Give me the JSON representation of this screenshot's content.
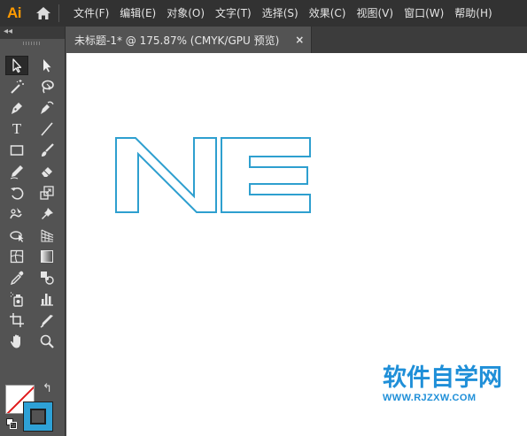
{
  "app": {
    "logo_text": "Ai",
    "logo_color": "#ff9a00",
    "home_icon": "home-icon"
  },
  "menu": {
    "items": [
      {
        "label": "文件(F)"
      },
      {
        "label": "编辑(E)"
      },
      {
        "label": "对象(O)"
      },
      {
        "label": "文字(T)"
      },
      {
        "label": "选择(S)"
      },
      {
        "label": "效果(C)"
      },
      {
        "label": "视图(V)"
      },
      {
        "label": "窗口(W)"
      },
      {
        "label": "帮助(H)"
      }
    ]
  },
  "document_tab": {
    "title": "未标题-1* @ 175.87% (CMYK/GPU 预览)",
    "close_label": "×"
  },
  "toolbar": {
    "collapse_label": "◂◂",
    "tools": [
      {
        "name": "selection-tool",
        "icon": "selection-arrow-icon",
        "active": true
      },
      {
        "name": "direct-selection-tool",
        "icon": "direct-selection-arrow-icon"
      },
      {
        "name": "magic-wand-tool",
        "icon": "magic-wand-icon"
      },
      {
        "name": "lasso-tool",
        "icon": "lasso-icon"
      },
      {
        "name": "pen-tool",
        "icon": "pen-icon"
      },
      {
        "name": "curvature-tool",
        "icon": "curvature-pen-icon"
      },
      {
        "name": "type-tool",
        "icon": "type-icon",
        "label": "T"
      },
      {
        "name": "line-segment-tool",
        "icon": "line-icon"
      },
      {
        "name": "rectangle-tool",
        "icon": "rectangle-icon"
      },
      {
        "name": "paintbrush-tool",
        "icon": "paintbrush-icon"
      },
      {
        "name": "pencil-tool",
        "icon": "pencil-icon"
      },
      {
        "name": "eraser-tool",
        "icon": "eraser-icon"
      },
      {
        "name": "rotate-tool",
        "icon": "rotate-icon"
      },
      {
        "name": "scale-tool",
        "icon": "scale-icon"
      },
      {
        "name": "warp-tool",
        "icon": "warp-icon"
      },
      {
        "name": "puppet-warp-tool",
        "icon": "pushpin-icon"
      },
      {
        "name": "free-transform-tool",
        "icon": "free-transform-icon"
      },
      {
        "name": "perspective-grid-tool",
        "icon": "perspective-grid-icon"
      },
      {
        "name": "mesh-tool",
        "icon": "mesh-icon"
      },
      {
        "name": "gradient-tool",
        "icon": "gradient-icon"
      },
      {
        "name": "eyedropper-tool",
        "icon": "eyedropper-icon"
      },
      {
        "name": "blend-tool",
        "icon": "blend-icon"
      },
      {
        "name": "symbol-sprayer-tool",
        "icon": "symbol-sprayer-icon"
      },
      {
        "name": "column-graph-tool",
        "icon": "column-graph-icon"
      },
      {
        "name": "artboard-tool",
        "icon": "artboard-icon"
      },
      {
        "name": "slice-tool",
        "icon": "slice-knife-icon"
      },
      {
        "name": "hand-tool",
        "icon": "hand-icon"
      },
      {
        "name": "zoom-tool",
        "icon": "zoom-icon"
      }
    ],
    "fill_color": "#ffffff",
    "stroke_color": "#2ea1d6",
    "swap_label": "↰",
    "modes": [
      {
        "name": "color-mode",
        "color": "#2ea1d6"
      },
      {
        "name": "gradient-mode",
        "color": "#cccccc"
      },
      {
        "name": "none-mode",
        "color": "#ffffff"
      }
    ]
  },
  "canvas": {
    "background": "#ffffff",
    "artwork_text": "NE",
    "artwork_stroke": "#2e9fcf"
  },
  "watermark": {
    "main": "软件自学网",
    "sub": "WWW.RJZXW.COM",
    "color": "#1f8fd8"
  }
}
